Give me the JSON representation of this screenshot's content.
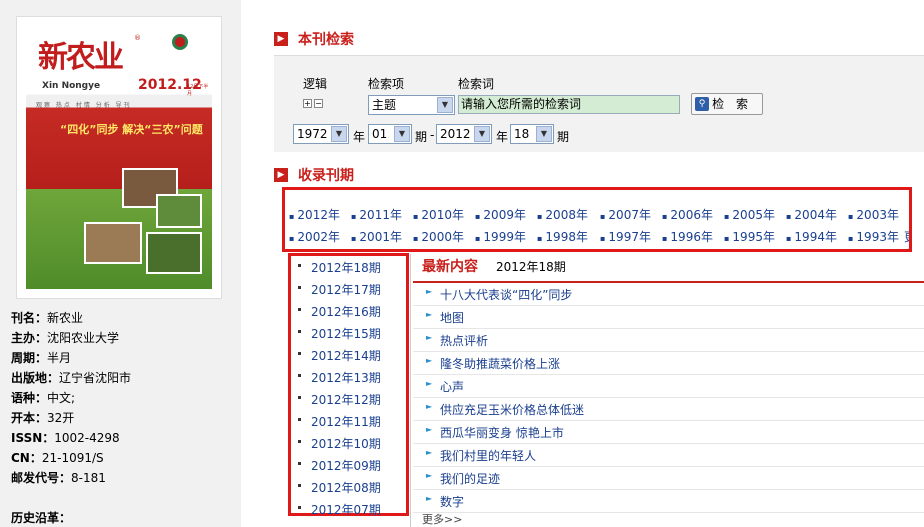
{
  "cover": {
    "title": "新农业",
    "title_reg": "®",
    "en_title": "Xin Nongye",
    "issue": "2012.12",
    "issue_suffix": "12月下半月",
    "menu": "观察 热点 村情 分析 导刊",
    "headline": "“四化”同步 解决“三农”问题"
  },
  "info": [
    {
      "label": "刊名：",
      "value": "新农业"
    },
    {
      "label": "主办：",
      "value": "沈阳农业大学"
    },
    {
      "label": "周期：",
      "value": "半月"
    },
    {
      "label": "出版地：",
      "value": "辽宁省沈阳市"
    },
    {
      "label": "语种：",
      "value": "中文;"
    },
    {
      "label": "开本：",
      "value": "32开"
    },
    {
      "label": "ISSN：",
      "value": "1002-4298"
    },
    {
      "label": "CN：",
      "value": "21-1091/S"
    },
    {
      "label": "邮发代号：",
      "value": "8-181"
    },
    {
      "label": "历史沿革：",
      "value": ""
    }
  ],
  "search_section": {
    "title": "本刊检索",
    "logic_label": "逻辑",
    "field_label": "检索项",
    "keyword_label": "检索词",
    "field_value": "主题",
    "keyword_placeholder": "请输入您所需的检索词",
    "button_label": "检 索",
    "from_year": "1972",
    "from_issue": "01",
    "to_year": "2012",
    "to_issue": "18",
    "year_unit": "年",
    "issue_unit": "期",
    "dash": "-"
  },
  "years_section": {
    "title": "收录刊期",
    "row1": [
      "2012年",
      "2011年",
      "2010年",
      "2009年",
      "2008年",
      "2007年",
      "2006年",
      "2005年",
      "2004年",
      "2003年"
    ],
    "row2": [
      "2002年",
      "2001年",
      "2000年",
      "1999年",
      "1998年",
      "1997年",
      "1996年",
      "1995年",
      "1994年",
      "1993年"
    ],
    "more": "更多"
  },
  "issues": [
    "2012年18期",
    "2012年17期",
    "2012年16期",
    "2012年15期",
    "2012年14期",
    "2012年13期",
    "2012年12期",
    "2012年11期",
    "2012年10期",
    "2012年09期",
    "2012年08期",
    "2012年07期"
  ],
  "latest": {
    "title": "最新内容",
    "issue": "2012年18期",
    "articles": [
      "十八大代表谈“四化”同步",
      "地图",
      "热点评析",
      "隆冬助推蔬菜价格上涨",
      "心声",
      "供应充足玉米价格总体低迷",
      "西瓜华丽变身 惊艳上市",
      "我们村里的年轻人",
      "我们的足迹",
      "数字"
    ],
    "more": "更多>>"
  }
}
